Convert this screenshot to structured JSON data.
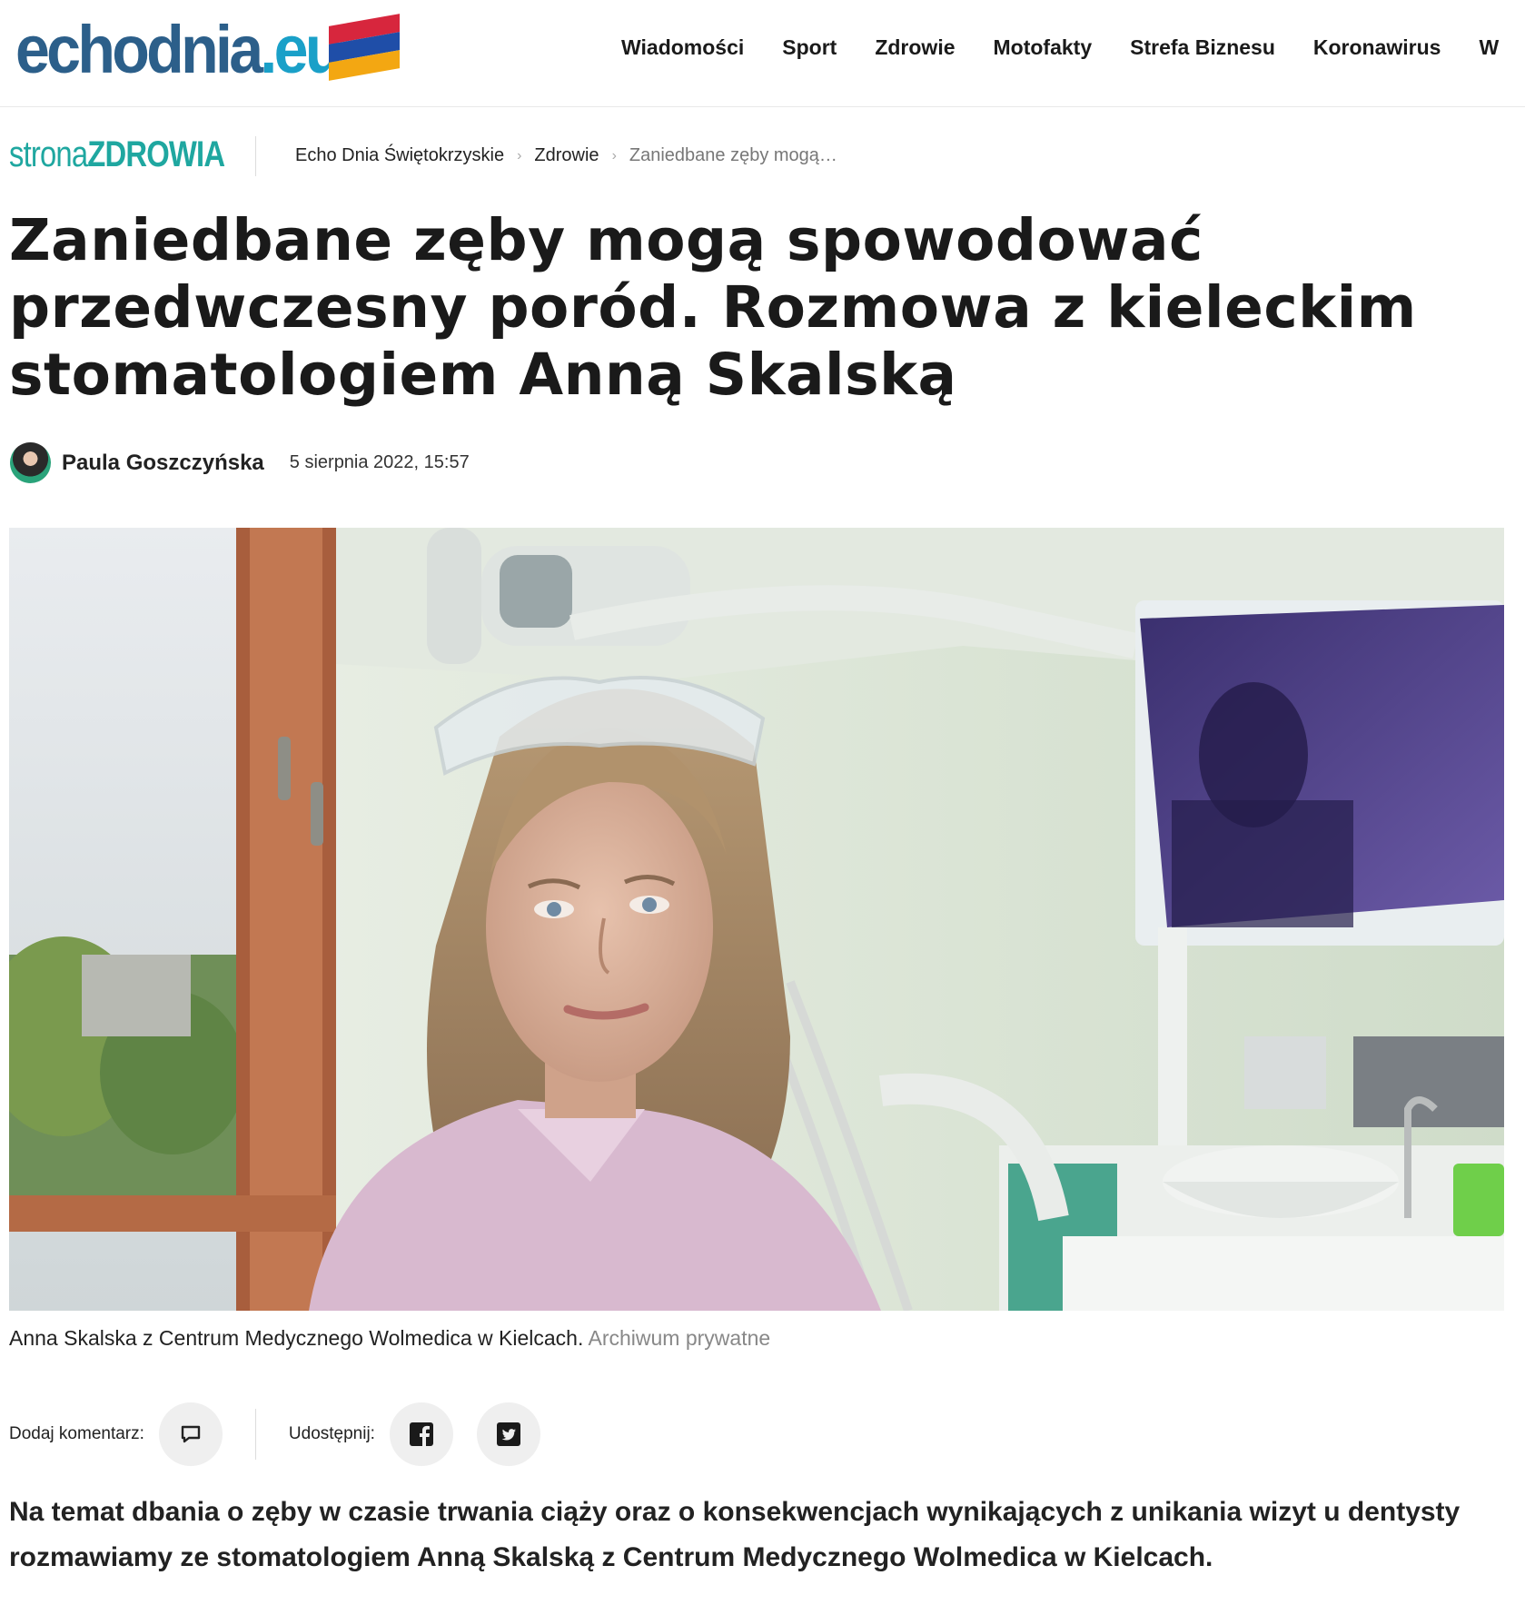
{
  "header": {
    "logo_main": "echodnia",
    "logo_tld": ".eu",
    "nav_items": [
      "Wiadomości",
      "Sport",
      "Zdrowie",
      "Motofakty",
      "Strefa Biznesu",
      "Koronawirus",
      "W"
    ]
  },
  "subheader": {
    "brand_prefix": "strona",
    "brand_suffix": "ZDROWIA",
    "breadcrumb": [
      "Echo Dnia Świętokrzyskie",
      "Zdrowie",
      "Zaniedbane zęby mogą…"
    ]
  },
  "article": {
    "title": "Zaniedbane zęby mogą spowodować przedwczesny poród. Rozmowa z kieleckim stomatologiem Anną Skalską",
    "author": "Paula Goszczyńska",
    "date": "5 sierpnia 2022, 15:57",
    "caption": "Anna Skalska z Centrum Medycznego Wolmedica w Kielcach.",
    "caption_credit": "Archiwum prywatne",
    "lead": "Na temat dbania o zęby w czasie trwania ciąży oraz o konsekwencjach wynikających z unikania wizyt u dentysty rozmawiamy ze stomatologiem Anną Skalską z Centrum Medycznego Wolmedica w Kielcach."
  },
  "share": {
    "comment_label": "Dodaj komentarz:",
    "share_label": "Udostępnij:"
  },
  "icons": {
    "comment": "comment-icon",
    "facebook": "facebook-icon",
    "twitter": "twitter-icon"
  },
  "colors": {
    "logo_blue": "#2c5f8a",
    "logo_tld": "#1aa0c8",
    "brand_teal": "#1fa7a0",
    "flag_white": "#f2f2f2",
    "flag_red": "#d7263d",
    "flag_orange": "#f3a712",
    "flag_blue": "#1f4ea8"
  }
}
